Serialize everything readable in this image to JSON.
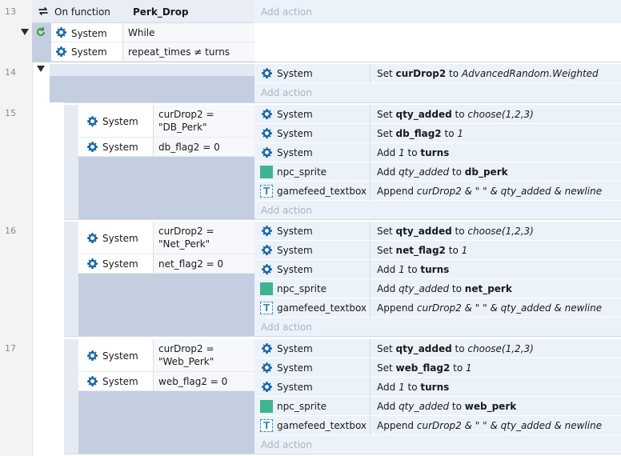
{
  "events": [
    {
      "line": "13",
      "trigger": {
        "prefix": "On function",
        "name": "Perk_Drop"
      },
      "add_action": "Add action",
      "loop": {
        "conditions": [
          {
            "object": "System",
            "text": "While"
          },
          {
            "object": "System",
            "text": "repeat_times ≠ turns"
          }
        ]
      }
    },
    {
      "line": "14",
      "actions": [
        {
          "object": "System",
          "verb": "Set",
          "target": "curDrop2",
          "mid": "to",
          "value": "AdvancedRandom.Weighted"
        }
      ],
      "add_action": "Add action"
    },
    {
      "line": "15",
      "conditions": [
        {
          "object": "System",
          "line1": "curDrop2 =",
          "line2": "\"DB_Perk\""
        },
        {
          "object": "System",
          "line1": "db_flag2 = 0"
        }
      ],
      "actions": [
        {
          "object": "System",
          "verb": "Set",
          "target": "qty_added",
          "mid": "to",
          "value": "choose(1,2,3)"
        },
        {
          "object": "System",
          "verb": "Set",
          "target": "db_flag2",
          "mid": "to",
          "value": "1"
        },
        {
          "object": "System",
          "verb": "Add",
          "amount": "1",
          "mid": "to",
          "target": "turns"
        },
        {
          "object": "npc_sprite",
          "verb": "Add",
          "amount": "qty_added",
          "mid": "to",
          "target": "db_perk"
        },
        {
          "object": "gamefeed_textbox",
          "verb": "Append",
          "expr": "curDrop2 & \"  \" & qty_added & newline"
        }
      ],
      "add_action": "Add action"
    },
    {
      "line": "16",
      "conditions": [
        {
          "object": "System",
          "line1": "curDrop2 =",
          "line2": "\"Net_Perk\""
        },
        {
          "object": "System",
          "line1": "net_flag2 = 0"
        }
      ],
      "actions": [
        {
          "object": "System",
          "verb": "Set",
          "target": "qty_added",
          "mid": "to",
          "value": "choose(1,2,3)"
        },
        {
          "object": "System",
          "verb": "Set",
          "target": "net_flag2",
          "mid": "to",
          "value": "1"
        },
        {
          "object": "System",
          "verb": "Add",
          "amount": "1",
          "mid": "to",
          "target": "turns"
        },
        {
          "object": "npc_sprite",
          "verb": "Add",
          "amount": "qty_added",
          "mid": "to",
          "target": "net_perk"
        },
        {
          "object": "gamefeed_textbox",
          "verb": "Append",
          "expr": "curDrop2 & \"  \" & qty_added & newline"
        }
      ],
      "add_action": "Add action"
    },
    {
      "line": "17",
      "conditions": [
        {
          "object": "System",
          "line1": "curDrop2 =",
          "line2": "\"Web_Perk\""
        },
        {
          "object": "System",
          "line1": "web_flag2 = 0"
        }
      ],
      "actions": [
        {
          "object": "System",
          "verb": "Set",
          "target": "qty_added",
          "mid": "to",
          "value": "choose(1,2,3)"
        },
        {
          "object": "System",
          "verb": "Set",
          "target": "web_flag2",
          "mid": "to",
          "value": "1"
        },
        {
          "object": "System",
          "verb": "Add",
          "amount": "1",
          "mid": "to",
          "target": "turns"
        },
        {
          "object": "npc_sprite",
          "verb": "Add",
          "amount": "qty_added",
          "mid": "to",
          "target": "web_perk"
        },
        {
          "object": "gamefeed_textbox",
          "verb": "Append",
          "expr": "curDrop2 & \"  \" & qty_added & newline"
        }
      ],
      "add_action": "Add action"
    }
  ]
}
